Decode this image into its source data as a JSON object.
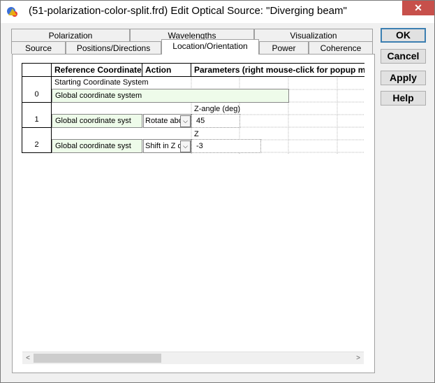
{
  "window": {
    "title": "(51-polarization-color-split.frd) Edit Optical Source: \"Diverging beam\"",
    "close_glyph": "✕"
  },
  "tabs_back": [
    {
      "label": "Polarization"
    },
    {
      "label": "Wavelengths"
    },
    {
      "label": "Visualization"
    }
  ],
  "tabs_front": [
    {
      "label": "Source"
    },
    {
      "label": "Positions/Directions"
    },
    {
      "label": "Location/Orientation",
      "active": true
    },
    {
      "label": "Power"
    },
    {
      "label": "Coherence"
    }
  ],
  "grid": {
    "headers": {
      "ref": "Reference Coordinate System",
      "action": "Action",
      "params": "Parameters (right mouse-click for popup menu)"
    },
    "rows": [
      {
        "num": "0",
        "caption": "Starting Coordinate System",
        "ref": "Global coordinate system"
      },
      {
        "num": "1",
        "ref": "Global coordinate syst",
        "action": "Rotate about Z axis",
        "param_label": "Z-angle (deg)",
        "param_value": "45"
      },
      {
        "num": "2",
        "ref": "Global coordinate syst",
        "action": "Shift in Z direction",
        "param_label": "Z",
        "param_value": "-3"
      }
    ]
  },
  "buttons": {
    "ok": "OK",
    "cancel": "Cancel",
    "apply": "Apply",
    "help": "Help"
  },
  "scrollbar": {
    "left_arrow": "<",
    "right_arrow": ">"
  },
  "colors": {
    "close": "#c7504b",
    "green_cell": "#eefbea"
  }
}
